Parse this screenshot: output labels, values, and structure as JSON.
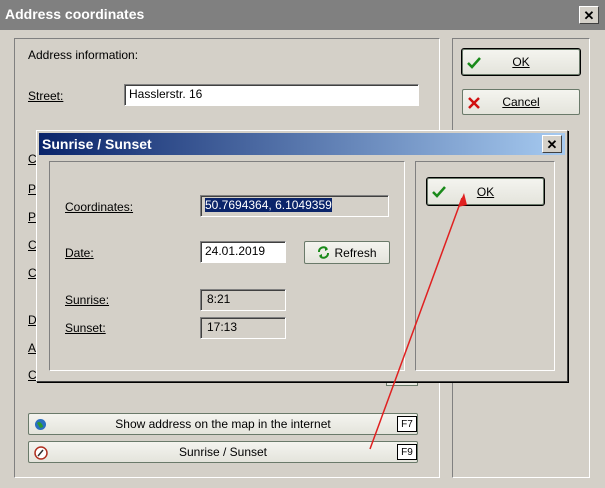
{
  "main_window": {
    "title": "Address coordinates",
    "close_label": "✕",
    "address_info_label": "Address information:",
    "street_label": "Street:",
    "street_value": "Hasslerstr. 16",
    "hidden_labels": [
      "C",
      "P",
      "P",
      "C",
      "C",
      "D",
      "A",
      "C"
    ],
    "ok_label": "OK",
    "cancel_label": "Cancel",
    "show_map_label": "Show address on the map in the internet",
    "show_map_key": "F7",
    "sunrise_sunset_label": "Sunrise / Sunset",
    "sunrise_sunset_key": "F9"
  },
  "dialog": {
    "title": "Sunrise / Sunset",
    "close_label": "✕",
    "coordinates_label": "Coordinates:",
    "coordinates_value": "50.7694364, 6.1049359",
    "date_label": "Date:",
    "date_value": "24.01.2019",
    "refresh_label": "Refresh",
    "sunrise_label": "Sunrise:",
    "sunrise_value": "8:21",
    "sunset_label": "Sunset:",
    "sunset_value": "17:13",
    "ok_label": "OK"
  },
  "colors": {
    "titlebar_inactive": "#808080",
    "dialog_title_start": "#0a246a",
    "dialog_title_end": "#a6caf0",
    "annotation_arrow": "#e02020",
    "ok_check": "#1a8a1a",
    "cancel_x": "#d01010"
  }
}
